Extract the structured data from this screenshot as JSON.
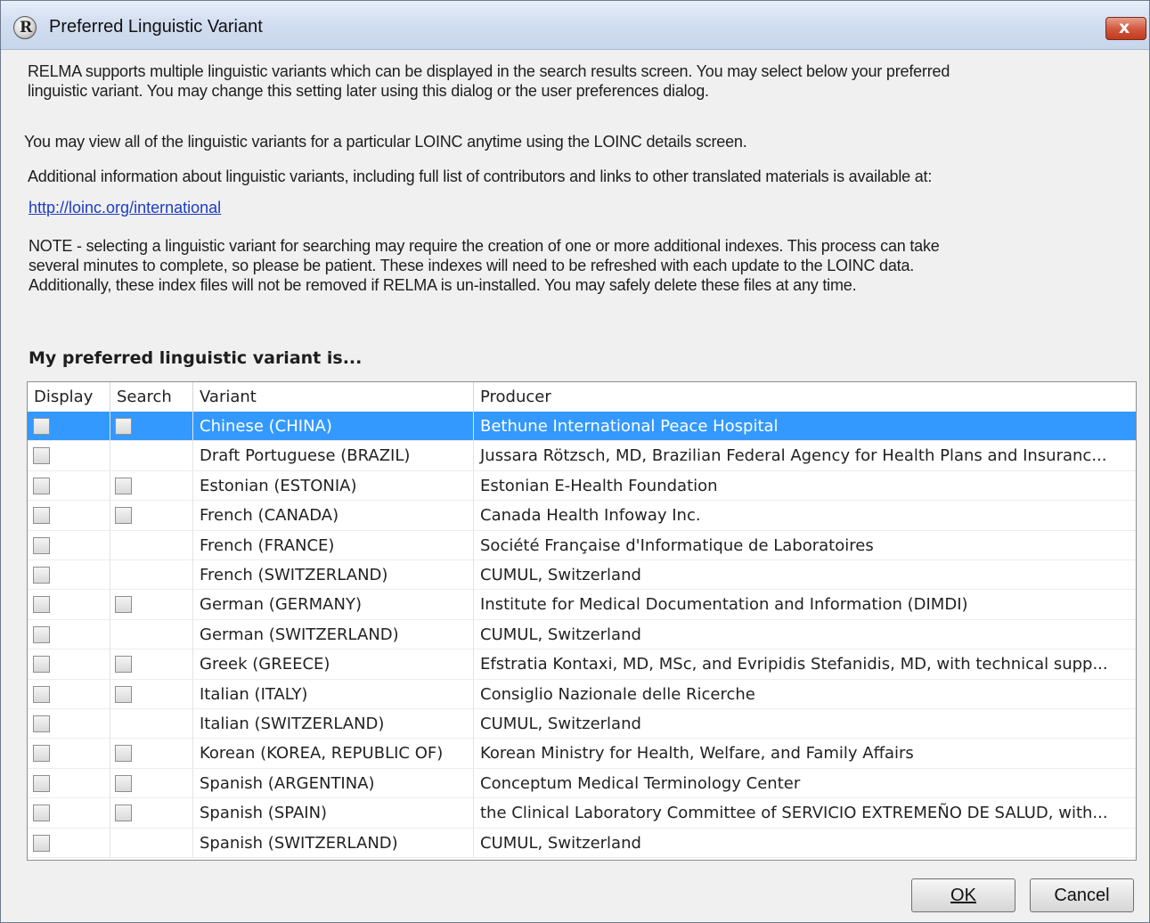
{
  "window": {
    "title": "Preferred Linguistic Variant",
    "close_label": "x"
  },
  "text": {
    "p1_line1": "RELMA supports multiple linguistic variants which can be displayed in the search results screen.  You may select below your preferred",
    "p1_line2": "linguistic variant. You may change this setting later using this dialog or the user preferences dialog.",
    "p2": "You may view all of the linguistic variants for a particular LOINC anytime using the LOINC details screen.",
    "p3": "Additional information about linguistic variants, including full list of contributors and links to other translated materials is available at:",
    "link": "http://loinc.org/international",
    "note_line1": "NOTE - selecting a linguistic variant for searching may require the creation of one or more additional indexes. This process can take",
    "note_line2": "several minutes to complete, so please be patient. These indexes will need to be refreshed with each update to the LOINC data.",
    "note_line3": "Additionally, these index files will not be removed if RELMA is un-installed. You may safely delete these files at any time.",
    "heading": "My preferred linguistic variant is..."
  },
  "grid": {
    "columns": [
      "Display",
      "Search",
      "Variant",
      "Producer"
    ],
    "rows": [
      {
        "variant": "Chinese (CHINA)",
        "producer": "Bethune International Peace Hospital",
        "display": false,
        "search": false,
        "has_search": true,
        "selected": true
      },
      {
        "variant": "Draft Portuguese (BRAZIL)",
        "producer": "Jussara Rötzsch, MD, Brazilian Federal Agency for Health Plans and Insuranc...",
        "display": false,
        "search": false,
        "has_search": false,
        "selected": false
      },
      {
        "variant": "Estonian (ESTONIA)",
        "producer": "Estonian E-Health Foundation",
        "display": false,
        "search": false,
        "has_search": true,
        "selected": false
      },
      {
        "variant": "French (CANADA)",
        "producer": "Canada Health Infoway Inc.",
        "display": false,
        "search": false,
        "has_search": true,
        "selected": false
      },
      {
        "variant": "French (FRANCE)",
        "producer": "Société Française d'Informatique de Laboratoires",
        "display": false,
        "search": false,
        "has_search": false,
        "selected": false
      },
      {
        "variant": "French (SWITZERLAND)",
        "producer": "CUMUL, Switzerland",
        "display": false,
        "search": false,
        "has_search": false,
        "selected": false
      },
      {
        "variant": "German (GERMANY)",
        "producer": "Institute for Medical Documentation and Information (DIMDI)",
        "display": false,
        "search": false,
        "has_search": true,
        "selected": false
      },
      {
        "variant": "German (SWITZERLAND)",
        "producer": "CUMUL, Switzerland",
        "display": false,
        "search": false,
        "has_search": false,
        "selected": false
      },
      {
        "variant": "Greek (GREECE)",
        "producer": "Efstratia Kontaxi, MD, MSc, and Evripidis Stefanidis, MD, with technical supp...",
        "display": false,
        "search": false,
        "has_search": true,
        "selected": false
      },
      {
        "variant": "Italian (ITALY)",
        "producer": "Consiglio Nazionale delle Ricerche",
        "display": false,
        "search": false,
        "has_search": true,
        "selected": false
      },
      {
        "variant": "Italian (SWITZERLAND)",
        "producer": "CUMUL, Switzerland",
        "display": false,
        "search": false,
        "has_search": false,
        "selected": false
      },
      {
        "variant": "Korean (KOREA, REPUBLIC OF)",
        "producer": "Korean Ministry for Health, Welfare, and Family Affairs",
        "display": false,
        "search": false,
        "has_search": true,
        "selected": false
      },
      {
        "variant": "Spanish (ARGENTINA)",
        "producer": "Conceptum Medical Terminology Center",
        "display": false,
        "search": false,
        "has_search": true,
        "selected": false
      },
      {
        "variant": "Spanish (SPAIN)",
        "producer": "the Clinical Laboratory Committee of SERVICIO EXTREMEÑO DE SALUD, with...",
        "display": false,
        "search": false,
        "has_search": true,
        "selected": false
      },
      {
        "variant": "Spanish (SWITZERLAND)",
        "producer": "CUMUL, Switzerland",
        "display": false,
        "search": false,
        "has_search": false,
        "selected": false
      }
    ]
  },
  "buttons": {
    "ok": "OK",
    "cancel": "Cancel"
  },
  "colors": {
    "selection": "#3399ff",
    "link": "#1d3cc4",
    "close_button": "#c13a1f"
  }
}
